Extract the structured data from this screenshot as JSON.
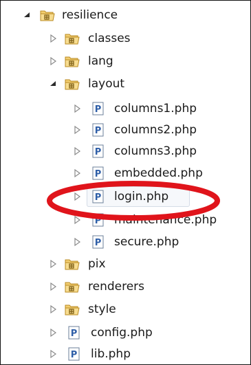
{
  "tree": {
    "root": {
      "label": "resilience",
      "expanded": true
    },
    "items": [
      {
        "label": "classes",
        "type": "folder",
        "level": 1,
        "expanded": false
      },
      {
        "label": "lang",
        "type": "folder",
        "level": 1,
        "expanded": false
      },
      {
        "label": "layout",
        "type": "folder",
        "level": 1,
        "expanded": true
      },
      {
        "label": "columns1.php",
        "type": "php-file",
        "level": 2
      },
      {
        "label": "columns2.php",
        "type": "php-file",
        "level": 2
      },
      {
        "label": "columns3.php",
        "type": "php-file",
        "level": 2
      },
      {
        "label": "embedded.php",
        "type": "php-file",
        "level": 2
      },
      {
        "label": "login.php",
        "type": "php-file",
        "level": 2,
        "selected": true,
        "highlighted": true
      },
      {
        "label": "maintenance.php",
        "type": "php-file",
        "level": 2
      },
      {
        "label": "secure.php",
        "type": "php-file",
        "level": 2
      },
      {
        "label": "pix",
        "type": "folder",
        "level": 1,
        "expanded": false
      },
      {
        "label": "renderers",
        "type": "folder",
        "level": 1,
        "expanded": false
      },
      {
        "label": "style",
        "type": "folder",
        "level": 1,
        "expanded": false
      },
      {
        "label": "config.php",
        "type": "php-file",
        "level": 1
      },
      {
        "label": "lib.php",
        "type": "php-file",
        "level": 1
      }
    ]
  },
  "colors": {
    "annotation": "#e0141b",
    "folder": "#e9b94c",
    "php_icon": "#2f5fa8"
  }
}
